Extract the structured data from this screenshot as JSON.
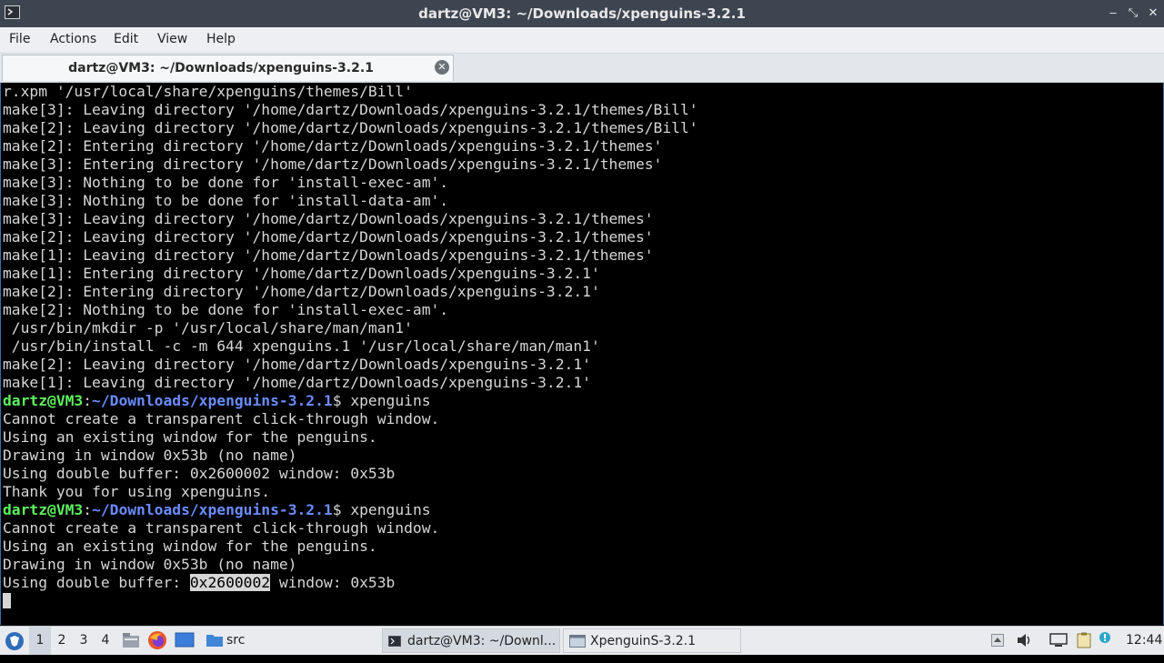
{
  "window": {
    "title": "dartz@VM3: ~/Downloads/xpenguins-3.2.1",
    "minimize": "‒",
    "maximize": "⤡",
    "close": "✕"
  },
  "menu": [
    "File",
    "Actions",
    "Edit",
    "View",
    "Help"
  ],
  "tab": {
    "label": "dartz@VM3: ~/Downloads/xpenguins-3.2.1"
  },
  "terminal": {
    "lines_before": [
      "r.xpm '/usr/local/share/xpenguins/themes/Bill'",
      "make[3]: Leaving directory '/home/dartz/Downloads/xpenguins-3.2.1/themes/Bill'",
      "make[2]: Leaving directory '/home/dartz/Downloads/xpenguins-3.2.1/themes/Bill'",
      "make[2]: Entering directory '/home/dartz/Downloads/xpenguins-3.2.1/themes'",
      "make[3]: Entering directory '/home/dartz/Downloads/xpenguins-3.2.1/themes'",
      "make[3]: Nothing to be done for 'install-exec-am'.",
      "make[3]: Nothing to be done for 'install-data-am'.",
      "make[3]: Leaving directory '/home/dartz/Downloads/xpenguins-3.2.1/themes'",
      "make[2]: Leaving directory '/home/dartz/Downloads/xpenguins-3.2.1/themes'",
      "make[1]: Leaving directory '/home/dartz/Downloads/xpenguins-3.2.1/themes'",
      "make[1]: Entering directory '/home/dartz/Downloads/xpenguins-3.2.1'",
      "make[2]: Entering directory '/home/dartz/Downloads/xpenguins-3.2.1'",
      "make[2]: Nothing to be done for 'install-exec-am'.",
      " /usr/bin/mkdir -p '/usr/local/share/man/man1'",
      " /usr/bin/install -c -m 644 xpenguins.1 '/usr/local/share/man/man1'",
      "make[2]: Leaving directory '/home/dartz/Downloads/xpenguins-3.2.1'",
      "make[1]: Leaving directory '/home/dartz/Downloads/xpenguins-3.2.1'"
    ],
    "prompt_user": "dartz@VM3",
    "prompt_colon": ":",
    "prompt_path": "~/Downloads/xpenguins-3.2.1",
    "prompt_dollar": "$ ",
    "command": "xpenguins",
    "run1": [
      "Cannot create a transparent click-through window.",
      "Using an existing window for the penguins.",
      "Drawing in window 0x53b (no name)",
      "Using double buffer: 0x2600002 window: 0x53b",
      "Thank you for using xpenguins."
    ],
    "run2": [
      "Cannot create a transparent click-through window.",
      "Using an existing window for the penguins.",
      "Drawing in window 0x53b (no name)"
    ],
    "last_prefix": "Using double buffer: ",
    "last_selected": "0x2600002",
    "last_suffix": " window: 0x53b"
  },
  "taskbar": {
    "workspaces": [
      "1",
      "2",
      "3",
      "4"
    ],
    "quick_folder": "src",
    "tasks": [
      "dartz@VM3: ~/Downl...",
      "XpenguinS-3.2.1"
    ],
    "clock": "12:44"
  },
  "colors": {
    "titlebar": "#3d4551",
    "prompt_user": "#5ef05e",
    "prompt_path": "#6a8cff",
    "terminal_fg": "#d6d6d6"
  }
}
